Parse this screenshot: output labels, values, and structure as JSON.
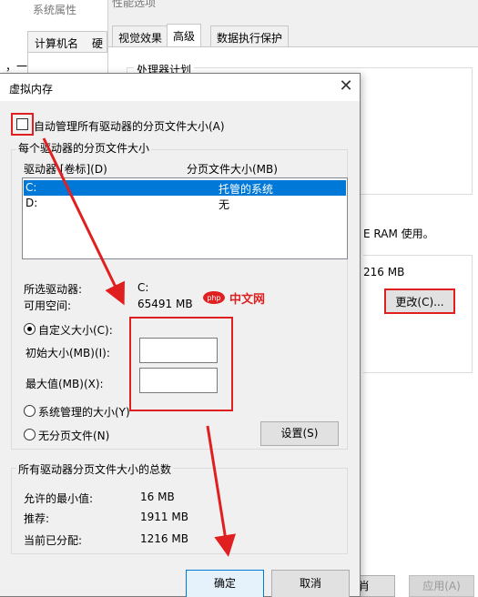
{
  "background": {
    "sys_props": {
      "title": "系统属性",
      "tabs": [
        "计算机名",
        "硬"
      ],
      "dash": "，一"
    },
    "perf_options": {
      "title": "性能选项",
      "tabs": [
        "视觉效果",
        "高级",
        "数据执行保护"
      ],
      "group_label": "处理器计划",
      "ram_text": "E RAM 使用。",
      "mb_text": "216 MB",
      "change_button": "更改(C)...",
      "bottom_buttons": [
        "肖",
        "应用(A)"
      ]
    }
  },
  "dialog": {
    "title": "虚拟内存",
    "close_glyph": "✕",
    "auto_manage_label": "自动管理所有驱动器的分页文件大小(A)",
    "auto_manage_checked": false,
    "per_drive_group": "每个驱动器的分页文件大小",
    "columns": {
      "drive": "驱动器 [卷标](D)",
      "size": "分页文件大小(MB)"
    },
    "drives": [
      {
        "drive": "C:",
        "size": "托管的系统",
        "selected": true
      },
      {
        "drive": "D:",
        "size": "无",
        "selected": false
      }
    ],
    "selected_drive_label": "所选驱动器:",
    "selected_drive_value": "C:",
    "free_space_label": "可用空间:",
    "free_space_value": "65491 MB",
    "custom_size_label": "自定义大小(C):",
    "initial_size_label": "初始大小(MB)(I):",
    "initial_size_value": "",
    "max_size_label": "最大值(MB)(X):",
    "max_size_value": "",
    "system_managed_label": "系统管理的大小(Y)",
    "no_paging_label": "无分页文件(N)",
    "selected_option": "custom",
    "set_button": "设置(S)",
    "total_group": "所有驱动器分页文件大小的总数",
    "totals": [
      {
        "label": "允许的最小值:",
        "value": "16 MB"
      },
      {
        "label": "推荐:",
        "value": "1911 MB"
      },
      {
        "label": "当前已分配:",
        "value": "1216 MB"
      }
    ],
    "ok_button": "确定",
    "cancel_button": "取消"
  },
  "watermark": {
    "brand": "php",
    "text": "中文网"
  },
  "colors": {
    "selection": "#0078d7",
    "annotation": "#e02020"
  }
}
